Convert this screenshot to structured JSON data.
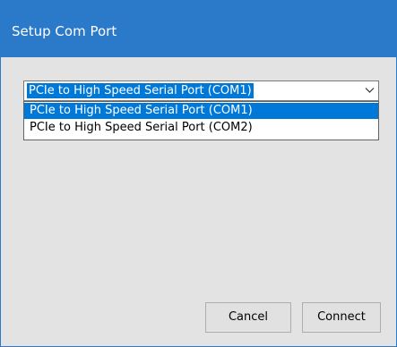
{
  "window": {
    "title": "Setup Com Port",
    "accent_color": "#2b79c9"
  },
  "port_select": {
    "selected_value": "PCIe to High Speed Serial Port (COM1)",
    "options": [
      "PCIe to High Speed Serial Port (COM1)",
      "PCIe to High Speed Serial Port (COM2)"
    ],
    "highlighted_index": 0,
    "arrow_icon": "chevron-down-icon"
  },
  "buttons": {
    "cancel_label": "Cancel",
    "connect_label": "Connect"
  }
}
